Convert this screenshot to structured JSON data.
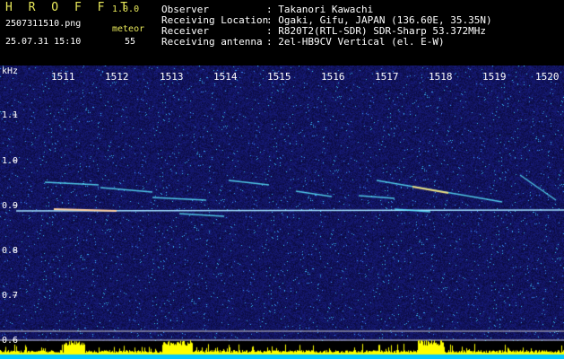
{
  "header": {
    "app_name": "H R O F F T",
    "version": "1.0.0",
    "filename": "2507311510.png",
    "datetime": "25.07.31 15:10",
    "meteor_label": "meteor",
    "meteor_count": "55"
  },
  "info": {
    "observer_key": "Observer",
    "observer_val": ": Takanori Kawachi",
    "location_key": "Receiving Location",
    "location_val": ": Ogaki, Gifu, JAPAN (136.60E, 35.35N)",
    "receiver_key": "Receiver",
    "receiver_val": ": R820T2(RTL-SDR) SDR-Sharp 53.372MHz",
    "antenna_key": "Receiving antenna",
    "antenna_val": ": 2el-HB9CV Vertical (el. E-W)"
  },
  "y_axis": {
    "unit": "kHz",
    "ticks": [
      "1.1",
      "1.0",
      "0.9",
      "0.8",
      "0.7",
      "0.6"
    ]
  },
  "x_axis": {
    "ticks": [
      "1511",
      "1512",
      "1513",
      "1514",
      "1515",
      "1516",
      "1517",
      "1518",
      "1519",
      "1520"
    ]
  },
  "colors": {
    "background": "#0a0a50",
    "text_yellow": "#e8e85a",
    "carrier": "#a0e0ff",
    "bottom_bar": "#ffff00",
    "bottom_base": "#00c8ff"
  }
}
